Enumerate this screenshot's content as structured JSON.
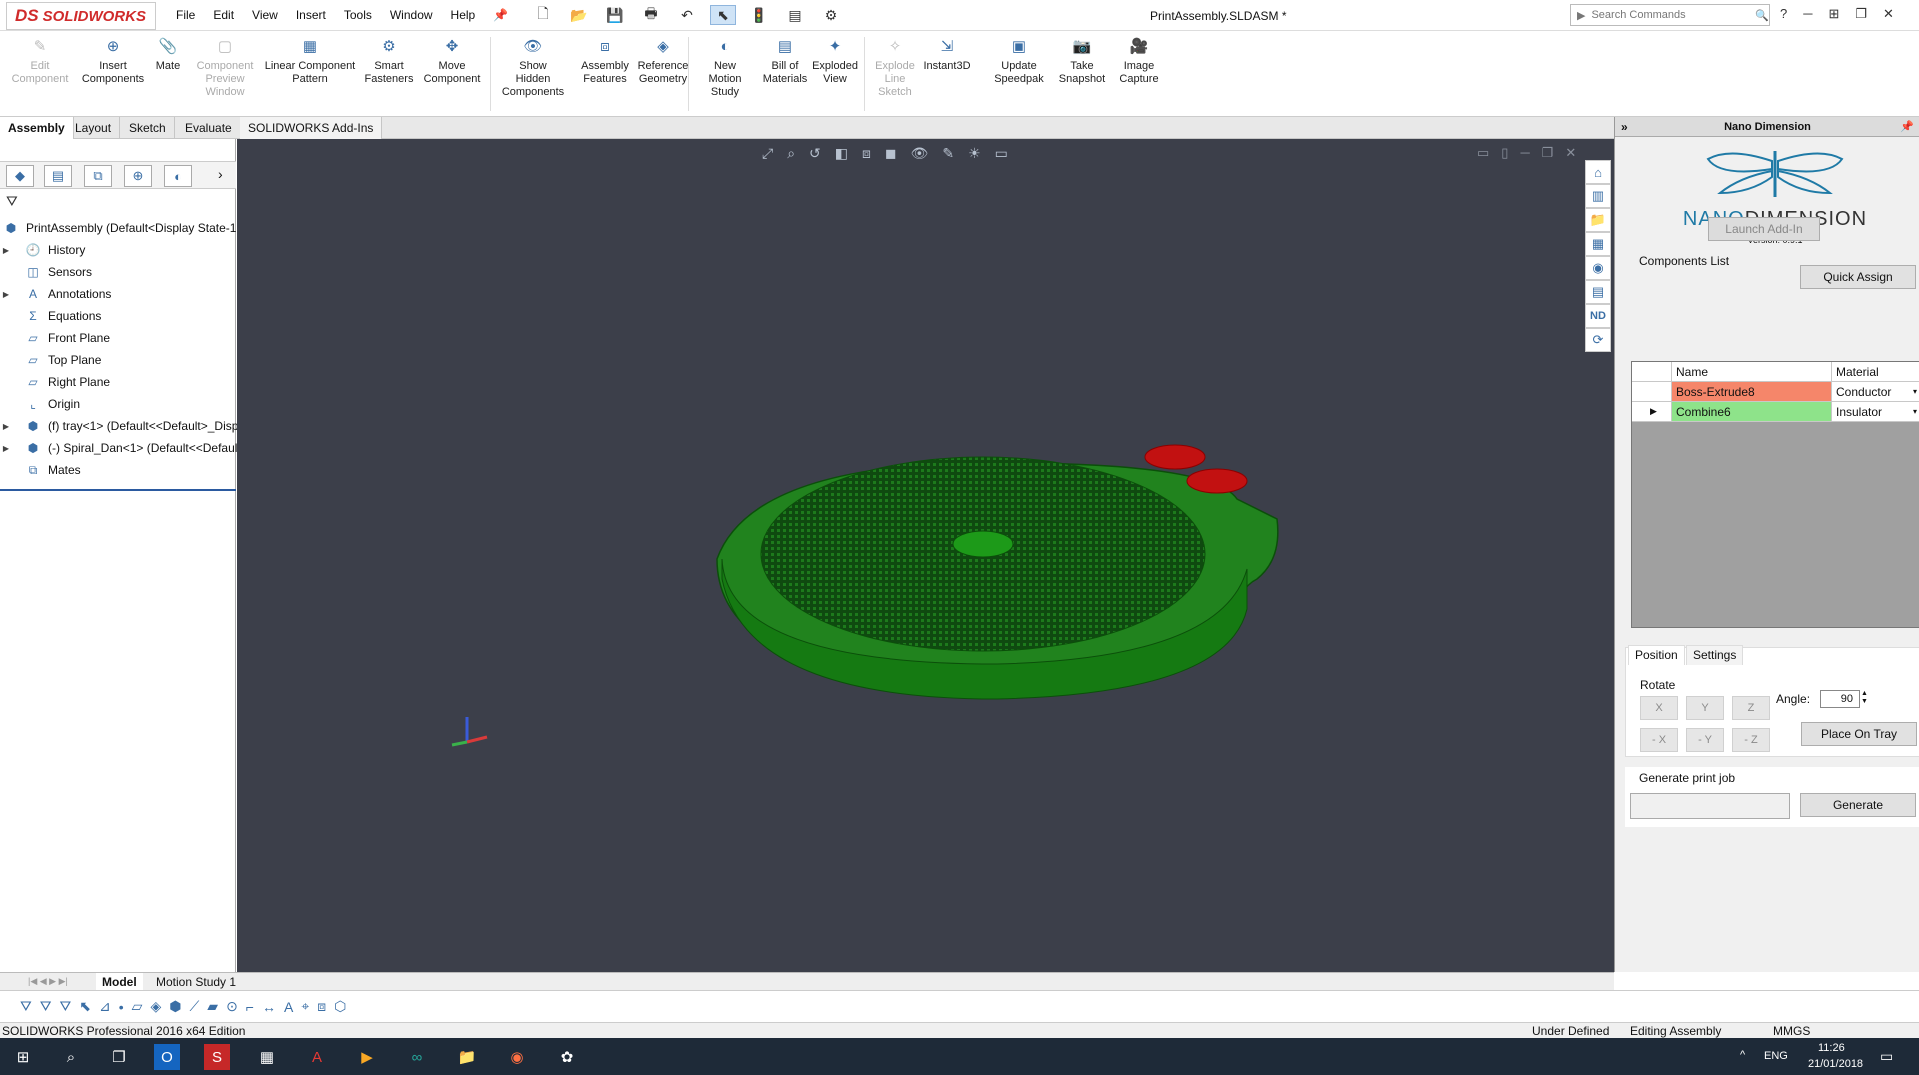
{
  "app": {
    "logo_ds": "DS",
    "logo_sw": "SOLIDWORKS",
    "document_title": "PrintAssembly.SLDASM *"
  },
  "menu": [
    "File",
    "Edit",
    "View",
    "Insert",
    "Tools",
    "Window",
    "Help"
  ],
  "search": {
    "placeholder": "Search Commands"
  },
  "ribbon": [
    {
      "label": "Edit\nComponent",
      "disabled": true
    },
    {
      "label": "Insert\nComponents",
      "disabled": false
    },
    {
      "label": "Mate",
      "disabled": false
    },
    {
      "label": "Component\nPreview\nWindow",
      "disabled": true
    },
    {
      "label": "Linear Component\nPattern",
      "disabled": false
    },
    {
      "label": "Smart\nFasteners",
      "disabled": false
    },
    {
      "label": "Move\nComponent",
      "disabled": false
    },
    {
      "label": "Show\nHidden\nComponents",
      "disabled": false
    },
    {
      "label": "Assembly\nFeatures",
      "disabled": false
    },
    {
      "label": "Reference\nGeometry",
      "disabled": false
    },
    {
      "label": "New\nMotion\nStudy",
      "disabled": false
    },
    {
      "label": "Bill of\nMaterials",
      "disabled": false
    },
    {
      "label": "Exploded\nView",
      "disabled": false
    },
    {
      "label": "Explode\nLine\nSketch",
      "disabled": true
    },
    {
      "label": "Instant3D",
      "disabled": false
    },
    {
      "label": "Update\nSpeedpak",
      "disabled": false
    },
    {
      "label": "Take\nSnapshot",
      "disabled": false
    },
    {
      "label": "Image\nCapture",
      "disabled": false
    }
  ],
  "command_tabs": [
    "Assembly",
    "Layout",
    "Sketch",
    "Evaluate",
    "SOLIDWORKS Add-Ins"
  ],
  "tree": {
    "root": "PrintAssembly  (Default<Display State-1",
    "items": [
      "History",
      "Sensors",
      "Annotations",
      "Equations",
      "Front Plane",
      "Top Plane",
      "Right Plane",
      "Origin",
      "(f) tray<1> (Default<<Default>_Disp",
      "(-) Spiral_Dan<1> (Default<<Defaul",
      "Mates"
    ]
  },
  "nano": {
    "panel_title": "Nano Dimension",
    "brand_nano": "NANO",
    "brand_dimension": "DIMENSION",
    "version": "Version: 0.9.1",
    "launch": "Launch Add-In",
    "components_list": "Components List",
    "quick_assign": "Quick Assign",
    "col_name": "Name",
    "col_material": "Material",
    "rows": [
      {
        "name": "Boss-Extrude8",
        "material": "Conductor",
        "color": "#f5866a"
      },
      {
        "name": "Combine6",
        "material": "Insulator",
        "color": "#8ee38a"
      }
    ],
    "tab_position": "Position",
    "tab_settings": "Settings",
    "rotate": "Rotate",
    "rot_buttons": [
      "X",
      "Y",
      "Z",
      "- X",
      "- Y",
      "- Z"
    ],
    "angle_label": "Angle:",
    "angle_value": "90",
    "place_on_tray": "Place On Tray",
    "gen_label": "Generate print job",
    "generate": "Generate"
  },
  "bottom_tabs": [
    "Model",
    "Motion Study 1"
  ],
  "status": {
    "edition": "SOLIDWORKS Professional 2016 x64 Edition",
    "defined": "Under Defined",
    "editing": "Editing Assembly",
    "units": "MMGS"
  },
  "taskbar": {
    "lang": "ENG",
    "time": "11:26",
    "date": "21/01/2018"
  }
}
